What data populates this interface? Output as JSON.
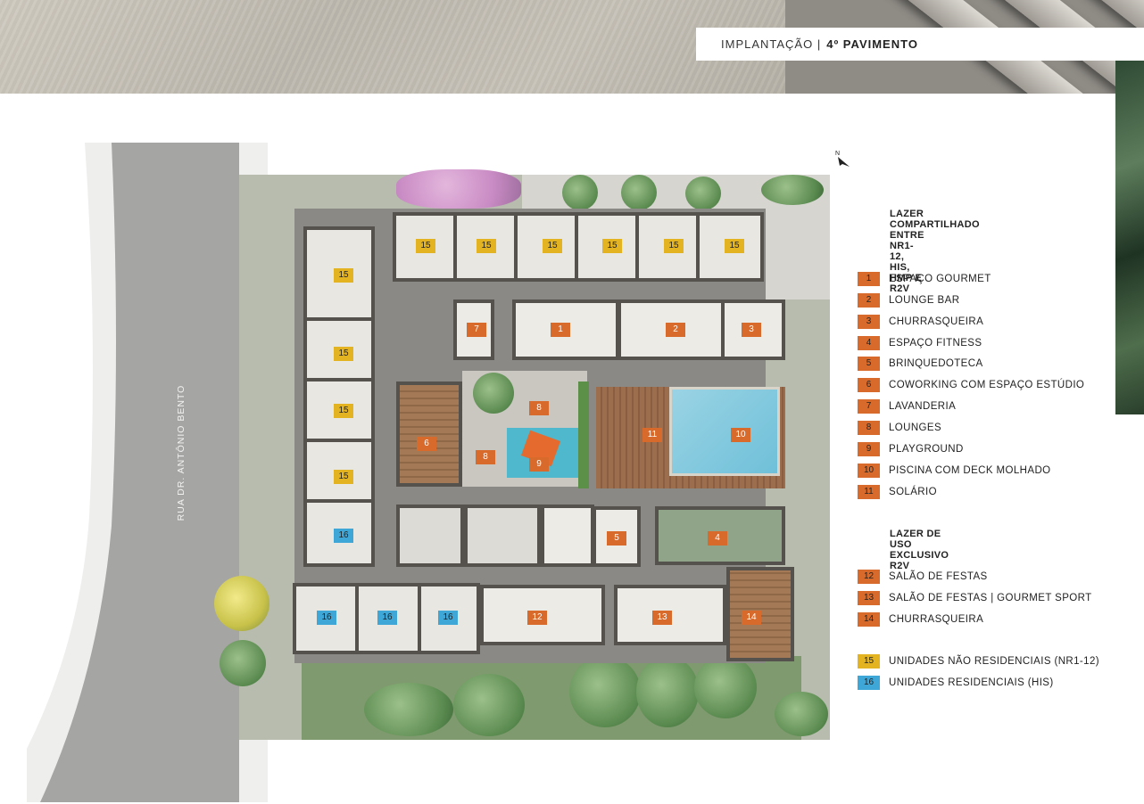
{
  "header": {
    "title_light": "IMPLANTAÇÃO |",
    "title_bold": "4º PAVIMENTO"
  },
  "street": {
    "name": "RUA DR. ANTÔNIO BENTO"
  },
  "north_arrow": {
    "label": "N"
  },
  "legend": {
    "shared_title_line1": "LAZER COMPARTILHADO",
    "shared_title_line2": "ENTRE NR1-12, HIS, HMP E R2V",
    "shared_items": [
      {
        "num": "1",
        "label": "ESPAÇO GOURMET"
      },
      {
        "num": "2",
        "label": "LOUNGE BAR"
      },
      {
        "num": "3",
        "label": "CHURRASQUEIRA"
      },
      {
        "num": "4",
        "label": "ESPAÇO FITNESS"
      },
      {
        "num": "5",
        "label": "BRINQUEDOTECA"
      },
      {
        "num": "6",
        "label": "COWORKING COM ESPAÇO ESTÚDIO"
      },
      {
        "num": "7",
        "label": "LAVANDERIA"
      },
      {
        "num": "8",
        "label": "LOUNGES"
      },
      {
        "num": "9",
        "label": "PLAYGROUND"
      },
      {
        "num": "10",
        "label": "PISCINA COM DECK MOLHADO"
      },
      {
        "num": "11",
        "label": "SOLÁRIO"
      }
    ],
    "exclusive_title": "LAZER DE USO EXCLUSIVO R2V",
    "exclusive_items": [
      {
        "num": "12",
        "label": "SALÃO DE FESTAS"
      },
      {
        "num": "13",
        "label": "SALÃO DE FESTAS | GOURMET SPORT"
      },
      {
        "num": "14",
        "label": "CHURRASQUEIRA"
      }
    ],
    "unit_items": [
      {
        "num": "15",
        "label": "UNIDADES NÃO RESIDENCIAIS (NR1-12)"
      },
      {
        "num": "16",
        "label": "UNIDADES RESIDENCIAIS (HIS)"
      }
    ]
  },
  "plan_labels": {
    "top_units": [
      "15",
      "15",
      "15",
      "15",
      "15",
      "15"
    ],
    "left_units": [
      "15",
      "15",
      "15",
      "15",
      "16"
    ],
    "bottom_units": [
      "16",
      "16",
      "16"
    ],
    "areas": {
      "a1": "1",
      "a2": "2",
      "a3": "3",
      "a4": "4",
      "a5": "5",
      "a6": "6",
      "a7": "7",
      "a8a": "8",
      "a8b": "8",
      "a9": "9",
      "a10": "10",
      "a11": "11",
      "a12": "12",
      "a13": "13",
      "a14": "14"
    }
  },
  "colors": {
    "shared_badge": "#d86a2b",
    "non_residential_badge": "#e3b321",
    "residential_badge": "#3ea7d7"
  }
}
